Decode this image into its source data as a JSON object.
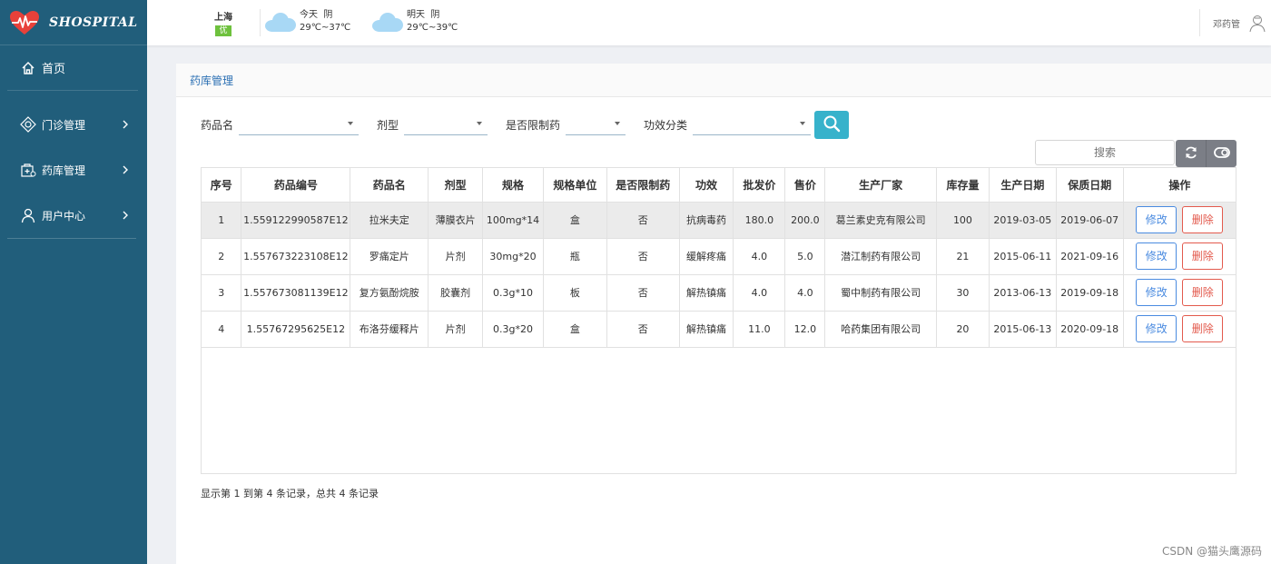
{
  "app": {
    "logo_text": "SHOSPITAL"
  },
  "colors": {
    "sidebar": "#215e7b",
    "accent": "#37b2cb",
    "edit": "#4a8be0",
    "delete": "#e35a4d",
    "title": "#2a6fb3"
  },
  "sidebar": {
    "home": "首页",
    "items": [
      {
        "label": "门诊管理",
        "icon": "clinic-icon"
      },
      {
        "label": "药库管理",
        "icon": "pharmacy-icon"
      },
      {
        "label": "用户中心",
        "icon": "user-icon"
      }
    ]
  },
  "topbar": {
    "city": "上海",
    "aqi": "优",
    "today": {
      "label": "今天",
      "condition": "阴",
      "temp": "29℃~37℃"
    },
    "tomorrow": {
      "label": "明天",
      "condition": "阴",
      "temp": "29℃~39℃"
    },
    "user_name": "邓药管"
  },
  "panel": {
    "title": "药库管理"
  },
  "filters": {
    "drug_name_label": "药品名",
    "dosage_label": "剂型",
    "restricted_label": "是否限制药",
    "efficacy_label": "功效分类"
  },
  "table_search_placeholder": "搜索",
  "table": {
    "headers": [
      "序号",
      "药品编号",
      "药品名",
      "剂型",
      "规格",
      "规格单位",
      "是否限制药",
      "功效",
      "批发价",
      "售价",
      "生产厂家",
      "库存量",
      "生产日期",
      "保质日期",
      "操作"
    ],
    "rows": [
      [
        "1",
        "1.559122990587E12",
        "拉米夫定",
        "薄膜衣片",
        "100mg*14",
        "盒",
        "否",
        "抗病毒药",
        "180.0",
        "200.0",
        "葛兰素史克有限公司",
        "100",
        "2019-03-05",
        "2019-06-07"
      ],
      [
        "2",
        "1.557673223108E12",
        "罗痛定片",
        "片剂",
        "30mg*20",
        "瓶",
        "否",
        "缓解疼痛",
        "4.0",
        "5.0",
        "潜江制药有限公司",
        "21",
        "2015-06-11",
        "2021-09-16"
      ],
      [
        "3",
        "1.557673081139E12",
        "复方氨酚烷胺",
        "胶囊剂",
        "0.3g*10",
        "板",
        "否",
        "解热镇痛",
        "4.0",
        "4.0",
        "蜀中制药有限公司",
        "30",
        "2013-06-13",
        "2019-09-18"
      ],
      [
        "4",
        "1.55767295625E12",
        "布洛芬缓释片",
        "片剂",
        "0.3g*20",
        "盒",
        "否",
        "解热镇痛",
        "11.0",
        "12.0",
        "哈药集团有限公司",
        "20",
        "2015-06-13",
        "2020-09-18"
      ]
    ],
    "edit_label": "修改",
    "delete_label": "删除"
  },
  "footer_info": "显示第 1 到第 4 条记录，总共 4 条记录",
  "watermark": "CSDN @猫头鹰源码"
}
